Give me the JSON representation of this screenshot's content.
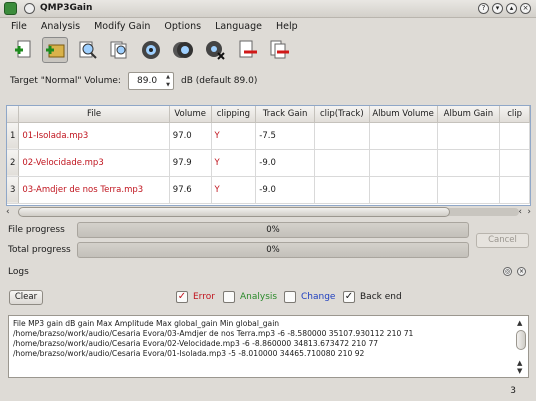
{
  "window": {
    "title": "QMP3Gain"
  },
  "menu": [
    "File",
    "Analysis",
    "Modify Gain",
    "Options",
    "Language",
    "Help"
  ],
  "toolbar": {
    "buttons": [
      "add-file-icon",
      "add-folder-icon",
      "track-analysis-icon",
      "album-analysis-icon",
      "track-gain-icon",
      "album-gain-icon",
      "constant-gain-icon",
      "clear-selected-icon",
      "clear-all-icon"
    ]
  },
  "target": {
    "label": "Target \"Normal\" Volume:",
    "value": "89.0",
    "unit_label": "dB (default 89.0)"
  },
  "table": {
    "columns": [
      "File",
      "Volume",
      "clipping",
      "Track Gain",
      "clip(Track)",
      "Album Volume",
      "Album Gain",
      "clip"
    ],
    "rows": [
      {
        "num": "1",
        "file": "01-Isolada.mp3",
        "volume": "97.0",
        "clipping": "Y",
        "track_gain": "-7.5",
        "clip_track": "",
        "album_volume": "",
        "album_gain": "",
        "clip": ""
      },
      {
        "num": "2",
        "file": "02-Velocidade.mp3",
        "volume": "97.9",
        "clipping": "Y",
        "track_gain": "-9.0",
        "clip_track": "",
        "album_volume": "",
        "album_gain": "",
        "clip": ""
      },
      {
        "num": "3",
        "file": "03-Amdjer de nos Terra.mp3",
        "volume": "97.6",
        "clipping": "Y",
        "track_gain": "-9.0",
        "clip_track": "",
        "album_volume": "",
        "album_gain": "",
        "clip": ""
      }
    ]
  },
  "progress": {
    "file_label": "File progress",
    "file_value": "0%",
    "file_fraction": 0,
    "total_label": "Total progress",
    "total_value": "0%",
    "total_fraction": 0,
    "cancel_label": "Cancel"
  },
  "logs": {
    "title": "Logs",
    "clear_label": "Clear",
    "filters": [
      {
        "label": "Error",
        "checked": true,
        "color": "#c0141e"
      },
      {
        "label": "Analysis",
        "checked": false,
        "color": "#2a8a2a"
      },
      {
        "label": "Change",
        "checked": false,
        "color": "#1f3fbf"
      },
      {
        "label": "Back end",
        "checked": true,
        "color": "#1a1a1a"
      }
    ],
    "lines": [
      "File MP3 gain dB gain Max Amplitude Max global_gain Min global_gain",
      "/home/brazso/work/audio/Cesaria Evora/03-Amdjer de nos Terra.mp3 -6 -8.580000 35107.930112 210 71",
      "/home/brazso/work/audio/Cesaria Evora/02-Velocidade.mp3 -6 -8.860000 34813.673472 210 77",
      "/home/brazso/work/audio/Cesaria Evora/01-Isolada.mp3 -5 -8.010000 34465.710080 210 92"
    ]
  },
  "status": {
    "count": "3"
  },
  "colors": {
    "accent_red": "#c0141e",
    "table_border": "#8fa7c8"
  }
}
